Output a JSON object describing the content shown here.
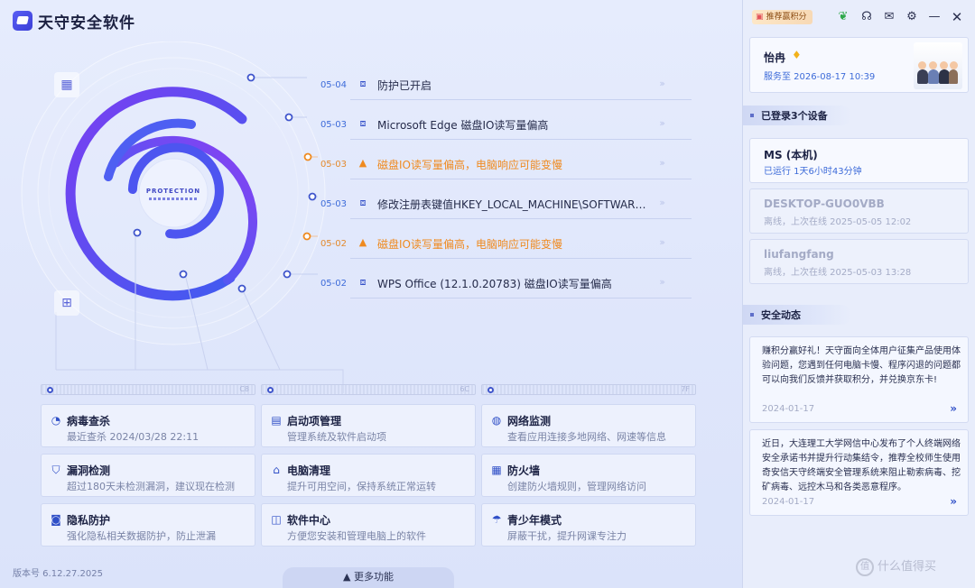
{
  "app": {
    "title": "天守安全软件",
    "version": "版本号 6.12.27.2025",
    "more_label": "更多功能"
  },
  "ring": {
    "center_label": "PROTECTION",
    "icons": [
      "monitor-icon",
      "cpu-icon"
    ]
  },
  "events": [
    {
      "date": "05-04",
      "text": "防护已开启",
      "level": "normal",
      "icon": "shield-pulse-icon"
    },
    {
      "date": "05-03",
      "text": "Microsoft Edge 磁盘IO读写量偏高",
      "level": "normal",
      "icon": "shield-pulse-icon"
    },
    {
      "date": "05-03",
      "text": "磁盘IO读写量偏高，电脑响应可能变慢",
      "level": "warn",
      "icon": "warning-icon"
    },
    {
      "date": "05-03",
      "text": "修改注册表键值HKEY_LOCAL_MACHINE\\SOFTWARE\\...",
      "level": "normal",
      "icon": "shield-pulse-icon"
    },
    {
      "date": "05-02",
      "text": "磁盘IO读写量偏高，电脑响应可能变慢",
      "level": "warn",
      "icon": "warning-icon"
    },
    {
      "date": "05-02",
      "text": "WPS Office (12.1.0.20783) 磁盘IO读写量偏高",
      "level": "normal",
      "icon": "shield-pulse-icon"
    }
  ],
  "dividers": [
    "C8",
    "6C",
    "7F"
  ],
  "features": [
    {
      "title": "病毒查杀",
      "desc": "最近查杀 2024/03/28 22:11",
      "icon": "virus-scan-icon"
    },
    {
      "title": "启动项管理",
      "desc": "管理系统及软件启动项",
      "icon": "startup-icon"
    },
    {
      "title": "网络监测",
      "desc": "查看应用连接多地网络、网速等信息",
      "icon": "globe-icon"
    },
    {
      "title": "漏洞检测",
      "desc": "超过180天未检测漏洞，建议现在检测",
      "icon": "shield-plus-icon"
    },
    {
      "title": "电脑清理",
      "desc": "提升可用空间，保持系统正常运转",
      "icon": "broom-icon"
    },
    {
      "title": "防火墙",
      "desc": "创建防火墙规则，管理网络访问",
      "icon": "firewall-icon"
    },
    {
      "title": "隐私防护",
      "desc": "强化隐私相关数据防护，防止泄漏",
      "icon": "privacy-icon"
    },
    {
      "title": "软件中心",
      "desc": "方便您安装和管理电脑上的软件",
      "icon": "software-center-icon"
    },
    {
      "title": "青少年模式",
      "desc": "屏蔽干扰，提升网课专注力",
      "icon": "umbrella-icon"
    }
  ],
  "side": {
    "gift_label": "推荐赢积分",
    "top_icons": [
      "leaf-icon",
      "headset-icon",
      "mail-icon",
      "gear-icon",
      "minimize-icon",
      "close-icon"
    ],
    "user": {
      "name": "怡冉",
      "expiry": "服务至 2026-08-17 10:39"
    },
    "devices_title": "已登录3个设备",
    "devices": [
      {
        "name": "MS (本机)",
        "status": "已运行 1天6小时43分钟",
        "active": true
      },
      {
        "name": "DESKTOP-GUO0VBB",
        "status": "离线，上次在线 2025-05-05 12:02",
        "active": false
      },
      {
        "name": "liufangfang",
        "status": "离线，上次在线 2025-05-03 13:28",
        "active": false
      }
    ],
    "news_title": "安全动态",
    "news": [
      {
        "text": "赚积分赢好礼！天守面向全体用户征集产品使用体验问题，您遇到任何电脑卡慢、程序闪退的问题都可以向我们反馈并获取积分，并兑换京东卡!",
        "date": "2024-01-17"
      },
      {
        "text": "近日，大连理工大学网信中心发布了个人终端网络安全承诺书并提升行动集结令，推荐全校师生使用奇安信天守终端安全管理系统来阻止勒索病毒、挖矿病毒、远控木马和各类恶意程序。",
        "date": "2024-01-17"
      }
    ]
  },
  "watermark": "值 什么值得买",
  "colors": {
    "accent": "#3f55cc",
    "warn": "#ef8a1f",
    "ring_purple": "#7b3ff0",
    "ring_blue": "#3a5af0"
  }
}
